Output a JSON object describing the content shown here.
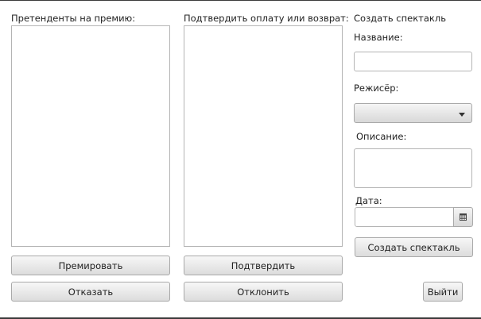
{
  "left_panel": {
    "label": "Претенденты на премию:",
    "award_button": "Премировать",
    "reject_button": "Отказать"
  },
  "middle_panel": {
    "label": "Подтвердить оплату или возврат:",
    "confirm_button": "Подтвердить",
    "decline_button": "Отклонить"
  },
  "create_play": {
    "title": "Создать спектакль",
    "name_label": "Название:",
    "name_value": "",
    "director_label": "Режисёр:",
    "director_value": "",
    "description_label": "Описание:",
    "description_value": "",
    "date_label": "Дата:",
    "date_value": "",
    "create_button": "Создать спектакль"
  },
  "exit_button": "Выйти",
  "icons": {
    "combo_arrow": "chevron-down-icon",
    "date_picker": "calendar-icon"
  }
}
